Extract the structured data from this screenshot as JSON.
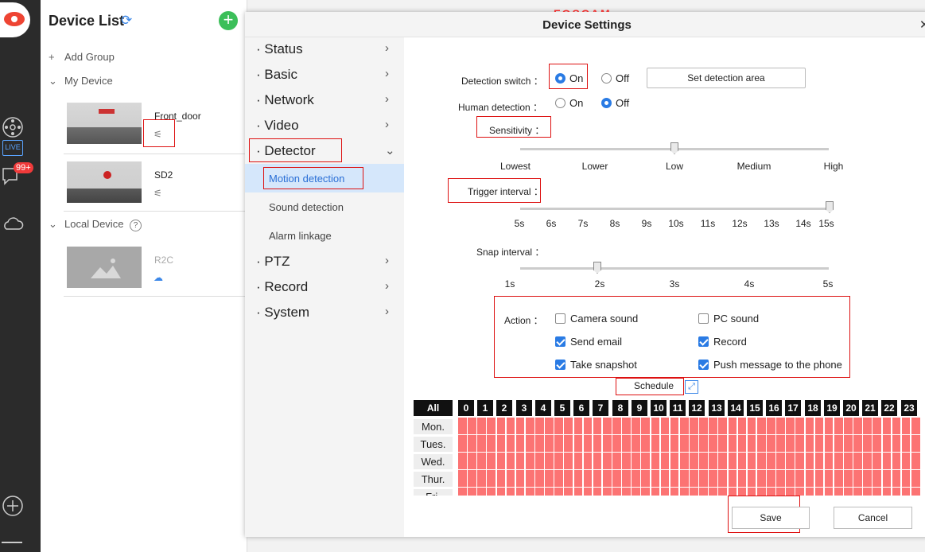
{
  "rail": {
    "live_label": "LIVE",
    "message_count": "99+"
  },
  "device_list": {
    "title": "Device List",
    "add_group": "Add Group",
    "my_device": "My Device",
    "devices": [
      {
        "name": "Front_door"
      },
      {
        "name": "SD2"
      }
    ],
    "local_device": "Local Device",
    "local_devices": [
      {
        "name": "R2C"
      }
    ]
  },
  "dialog": {
    "title": "Device Settings",
    "brand": "FOSCAM",
    "menu": [
      {
        "label": "· Status"
      },
      {
        "label": "· Basic"
      },
      {
        "label": "· Network"
      },
      {
        "label": "· Video"
      },
      {
        "label": "· Detector"
      },
      {
        "label": "· PTZ"
      },
      {
        "label": "· Record"
      },
      {
        "label": "· System"
      }
    ],
    "submenu": [
      {
        "label": "Motion detection",
        "active": true
      },
      {
        "label": "Sound detection"
      },
      {
        "label": "Alarm linkage"
      }
    ]
  },
  "detector": {
    "detection_switch_label": "Detection switch ：",
    "on_label": "On",
    "off_label": "Off",
    "detection_switch_value": "On",
    "set_area_button": "Set detection area",
    "human_detection_label": "Human detection ：",
    "human_detection_value": "Off",
    "sensitivity_label": "Sensitivity ：",
    "sensitivity_ticks": [
      "Lowest",
      "Lower",
      "Low",
      "Medium",
      "High"
    ],
    "sensitivity_value": "Low",
    "trigger_label": "Trigger interval ：",
    "trigger_ticks": [
      "5s",
      "6s",
      "7s",
      "8s",
      "9s",
      "10s",
      "11s",
      "12s",
      "13s",
      "14s",
      "15s"
    ],
    "trigger_value": "15s",
    "snap_label": "Snap interval ：",
    "snap_ticks": [
      "1s",
      "2s",
      "3s",
      "4s",
      "5s"
    ],
    "snap_value": "2s",
    "action_label": "Action ：",
    "actions": [
      {
        "label": "Camera sound",
        "checked": false
      },
      {
        "label": "PC sound",
        "checked": false
      },
      {
        "label": "Send email",
        "checked": true
      },
      {
        "label": "Record",
        "checked": true
      },
      {
        "label": "Take snapshot",
        "checked": true
      },
      {
        "label": "Push message to the phone",
        "checked": true
      }
    ],
    "schedule_label": "Schedule",
    "schedule_all": "All",
    "hours": [
      "0",
      "1",
      "2",
      "3",
      "4",
      "5",
      "6",
      "7",
      "8",
      "9",
      "10",
      "11",
      "12",
      "13",
      "14",
      "15",
      "16",
      "17",
      "18",
      "19",
      "20",
      "21",
      "22",
      "23"
    ],
    "days": [
      "Mon.",
      "Tues.",
      "Wed.",
      "Thur.",
      "Fri."
    ],
    "schedule_color": "#fc7373",
    "save_button": "Save",
    "cancel_button": "Cancel"
  }
}
